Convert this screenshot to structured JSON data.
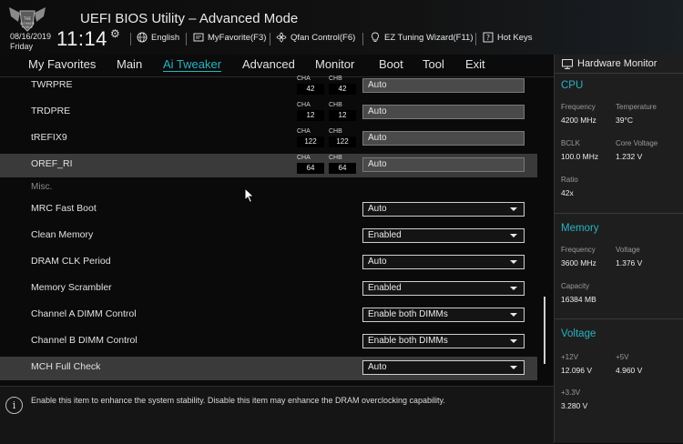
{
  "header": {
    "title": "UEFI BIOS Utility – Advanced Mode",
    "date": "08/16/2019",
    "day": "Friday",
    "time": "11:14",
    "tools": [
      {
        "label": "English",
        "icon": "globe-icon"
      },
      {
        "label": "MyFavorite(F3)",
        "icon": "favorite-icon"
      },
      {
        "label": "Qfan Control(F6)",
        "icon": "fan-icon"
      },
      {
        "label": "EZ Tuning Wizard(F11)",
        "icon": "lightbulb-icon"
      },
      {
        "label": "Hot Keys",
        "icon": "hotkeys-icon"
      }
    ]
  },
  "menu": {
    "items": [
      "My Favorites",
      "Main",
      "Ai Tweaker",
      "Advanced",
      "Monitor",
      "Boot",
      "Tool",
      "Exit"
    ],
    "active": "Ai Tweaker"
  },
  "settings": {
    "channel_rows": [
      {
        "label": "TWRPRE",
        "cha_name": "CHA",
        "cha": "42",
        "chb_name": "CHB",
        "chb": "42",
        "value": "Auto"
      },
      {
        "label": "TRDPRE",
        "cha_name": "CHA",
        "cha": "12",
        "chb_name": "CHB",
        "chb": "12",
        "value": "Auto"
      },
      {
        "label": "tREFIX9",
        "cha_name": "CHA",
        "cha": "122",
        "chb_name": "CHB",
        "chb": "122",
        "value": "Auto"
      },
      {
        "label": "OREF_RI",
        "cha_name": "CHA",
        "cha": "64",
        "chb_name": "CHB",
        "chb": "64",
        "value": "Auto"
      }
    ],
    "misc_label": "Misc.",
    "dropdown_rows": [
      {
        "label": "MRC Fast Boot",
        "value": "Auto"
      },
      {
        "label": "Clean Memory",
        "value": "Enabled"
      },
      {
        "label": "DRAM CLK Period",
        "value": "Auto"
      },
      {
        "label": "Memory Scrambler",
        "value": "Enabled"
      },
      {
        "label": "Channel A DIMM Control",
        "value": "Enable both DIMMs"
      },
      {
        "label": "Channel B DIMM Control",
        "value": "Enable both DIMMs"
      },
      {
        "label": "MCH Full Check",
        "value": "Auto"
      }
    ]
  },
  "help": {
    "text": "Enable this item to enhance the system stability. Disable this item may enhance the DRAM overclocking capability."
  },
  "hardware_monitor": {
    "title": "Hardware Monitor",
    "cpu": {
      "heading": "CPU",
      "frequency_label": "Frequency",
      "frequency": "4200 MHz",
      "temperature_label": "Temperature",
      "temperature": "39°C",
      "bclk_label": "BCLK",
      "bclk": "100.0 MHz",
      "core_voltage_label": "Core Voltage",
      "core_voltage": "1.232 V",
      "ratio_label": "Ratio",
      "ratio": "42x"
    },
    "memory": {
      "heading": "Memory",
      "frequency_label": "Frequency",
      "frequency": "3600 MHz",
      "voltage_label": "Voltage",
      "voltage": "1.376 V",
      "capacity_label": "Capacity",
      "capacity": "16384 MB"
    },
    "voltage": {
      "heading": "Voltage",
      "v12_label": "+12V",
      "v12": "12.096 V",
      "v5_label": "+5V",
      "v5": "4.960 V",
      "v33_label": "+3.3V",
      "v33": "3.280 V"
    }
  },
  "colors": {
    "accent": "#27b3c3",
    "background": "#0a0a0a",
    "highlight_row": "#3a3a3a",
    "panel": "#1e1e1e"
  }
}
